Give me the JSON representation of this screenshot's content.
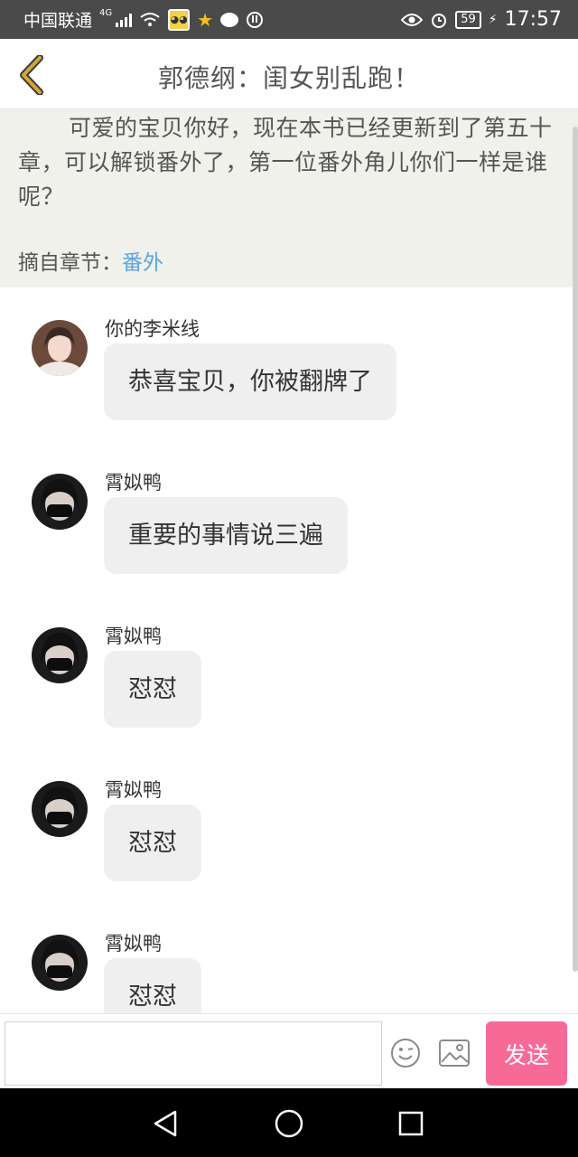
{
  "status_bar": {
    "carrier": "中国联通",
    "network": "4G",
    "battery": "59",
    "time": "17:57"
  },
  "header": {
    "title": "郭德纲：闺女别乱跑！"
  },
  "excerpt": {
    "text": "可爱的宝贝你好，现在本书已经更新到了第五十章，可以解锁番外了，第一位番外角儿你们一样是谁呢？",
    "source_label": "摘自章节：",
    "chapter": "番外"
  },
  "messages": [
    {
      "sender": "你的李米线",
      "text": "恭喜宝贝，你被翻牌了",
      "avatar": "girl-avatar"
    },
    {
      "sender": "霄姒鸭",
      "text": "重要的事情说三遍",
      "avatar": "masked-avatar"
    },
    {
      "sender": "霄姒鸭",
      "text": "怼怼",
      "avatar": "masked-avatar"
    },
    {
      "sender": "霄姒鸭",
      "text": "怼怼",
      "avatar": "masked-avatar"
    },
    {
      "sender": "霄姒鸭",
      "text": "怼怼",
      "avatar": "masked-avatar"
    }
  ],
  "input": {
    "placeholder": "",
    "send_label": "发送"
  },
  "colors": {
    "status_bar_bg": "#4a4a4a",
    "excerpt_bg": "#f1f1ec",
    "chapter_link": "#5aa3e0",
    "send_button": "#f76a98",
    "back_arrow": "#d4a63a",
    "bubble_bg": "#efefef"
  }
}
